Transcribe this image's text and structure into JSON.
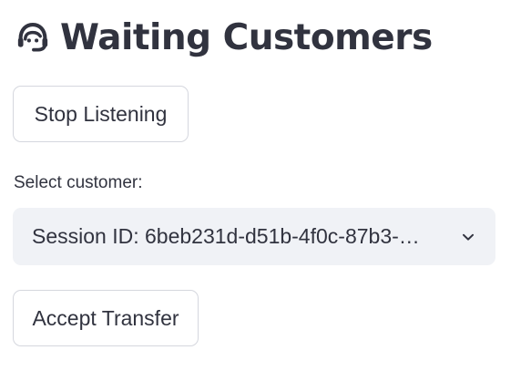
{
  "header": {
    "icon": "support-agent-icon",
    "title": "Waiting Customers"
  },
  "buttons": {
    "stop_listening": "Stop Listening",
    "accept_transfer": "Accept Transfer"
  },
  "customer_select": {
    "label": "Select customer:",
    "selected_value": "Session ID: 6beb231d-d51b-4f0c-87b3-…",
    "icon": "chevron-down-icon"
  },
  "colors": {
    "text": "#31333f",
    "select_background": "#f0f2f6",
    "button_border": "#d5d7de"
  }
}
